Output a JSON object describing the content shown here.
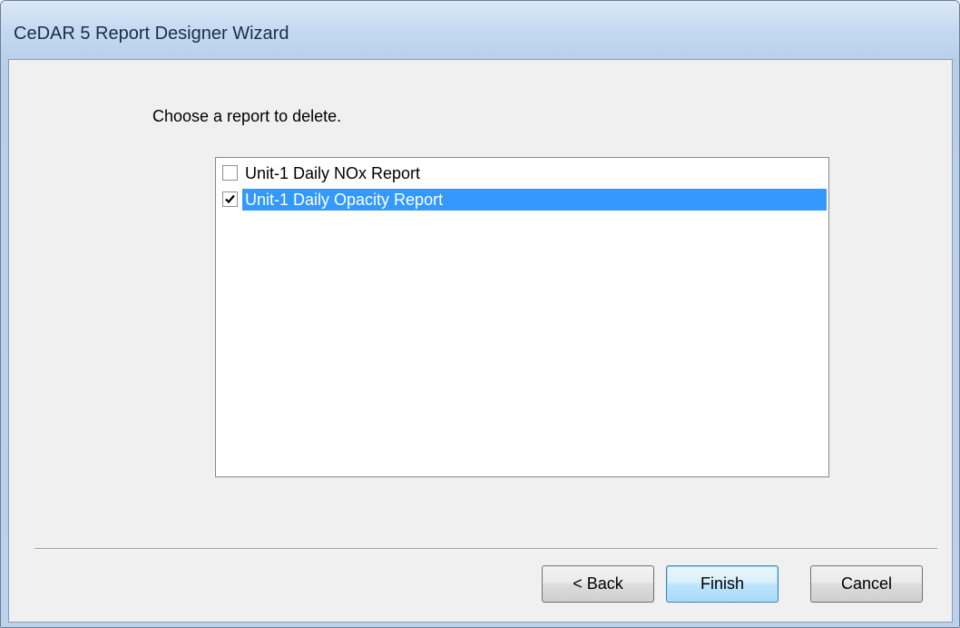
{
  "window": {
    "title": "CeDAR 5 Report Designer Wizard"
  },
  "main": {
    "prompt": "Choose a report to delete.",
    "reports": [
      {
        "label": "Unit-1 Daily NOx Report",
        "checked": false,
        "selected": false
      },
      {
        "label": "Unit-1 Daily Opacity Report",
        "checked": true,
        "selected": true
      }
    ]
  },
  "buttons": {
    "back": "< Back",
    "finish": "Finish",
    "cancel": "Cancel"
  },
  "colors": {
    "selection": "#3399ff",
    "titlebar": "#c5d9f1",
    "client_bg": "#f0f0f0"
  }
}
